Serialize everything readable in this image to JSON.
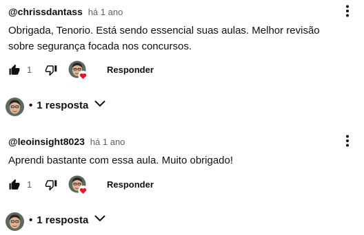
{
  "comments": [
    {
      "author": "@chrissdantass",
      "time": "há 1 ano",
      "text": "Obrigada, Tenorio. Está sendo essencial suas aulas. Melhor revisão sobre segurança focada nos concursos.",
      "likes": "1",
      "reply_label": "Responder",
      "replies_label": "1 resposta",
      "bullet": "•"
    },
    {
      "author": "@leoinsight8023",
      "time": "há 1 ano",
      "text": "Aprendi bastante com essa aula. Muito obrigado!",
      "likes": "1",
      "reply_label": "Responder",
      "replies_label": "1 resposta",
      "bullet": "•"
    }
  ],
  "icons": {
    "like": "thumb-up-icon",
    "dislike": "thumb-down-icon",
    "menu": "more-vert-icon",
    "expand": "chevron-down-icon",
    "heart": "heart-icon"
  },
  "colors": {
    "heart": "#e8162b",
    "text": "#0f0f0f",
    "secondary": "#606060"
  }
}
